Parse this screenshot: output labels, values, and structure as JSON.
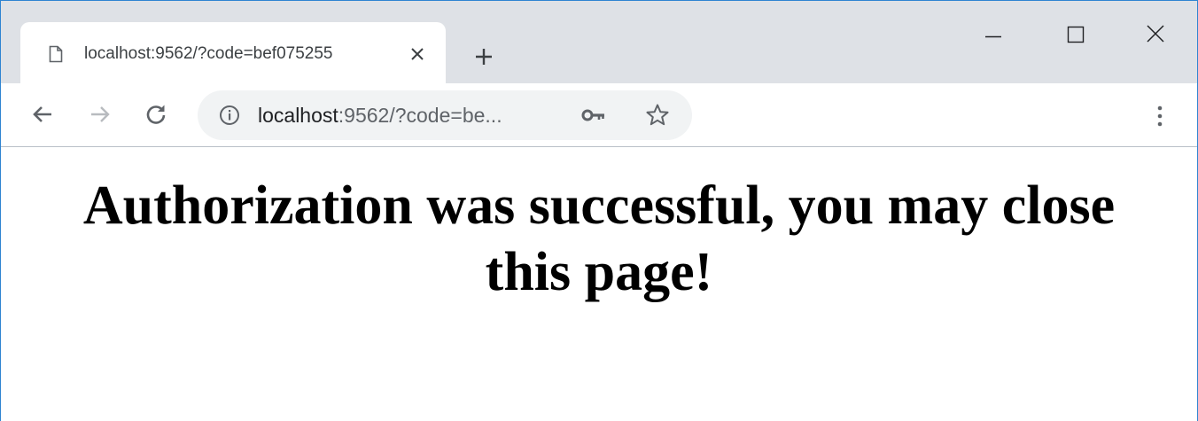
{
  "browser": {
    "tab": {
      "title": "localhost:9562/?code=bef075255",
      "favicon_icon": "page-icon",
      "close_icon": "close-icon"
    },
    "new_tab_icon": "plus-icon",
    "window_controls": [
      "minimize-icon",
      "maximize-icon",
      "close-icon"
    ],
    "nav": {
      "back_icon": "arrow-left-icon",
      "forward_icon": "arrow-right-icon",
      "reload_icon": "reload-icon"
    },
    "omnibox": {
      "info_icon": "info-icon",
      "url_host": "localhost",
      "url_rest": ":9562/?code=be...",
      "key_icon": "key-icon",
      "star_icon": "star-icon"
    },
    "menu_icon": "kebab-menu-icon"
  },
  "page": {
    "heading": "Authorization was successful, you may close this page!"
  },
  "colors": {
    "tabstrip": "#dee1e6",
    "window_border": "#2f84d1",
    "omnibox_bg": "#f1f3f4",
    "icon": "#5f6368"
  }
}
